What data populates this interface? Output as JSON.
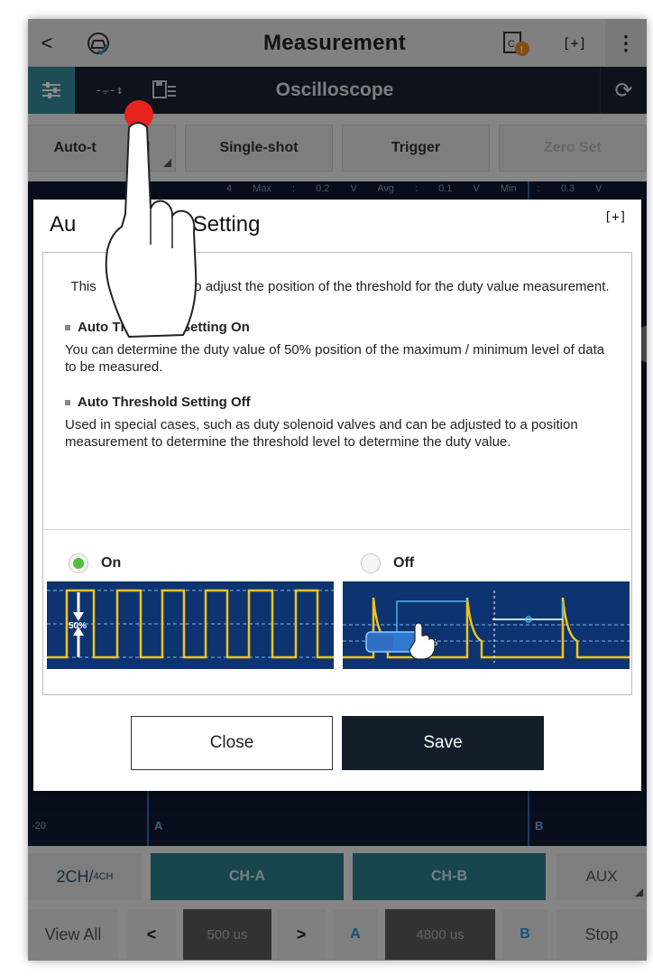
{
  "topbar": {
    "back_glyph": "<",
    "title": "Measurement",
    "fullscreen_glyph": "[+]",
    "menu_glyph": "⋮"
  },
  "scopebar": {
    "title": "Oscilloscope",
    "threshold_glyph": "-⨪-↕",
    "refresh_glyph": "⟳"
  },
  "tabs": {
    "auto": "Auto-t",
    "auto_tail": "d",
    "single": "Single-shot",
    "trigger": "Trigger",
    "zero": "Zero Set"
  },
  "scope": {
    "minmax": "4 Max : 0.2 V Avg : 0.1 V Min : 0.3 V",
    "axis_value": "-20",
    "cursor_a": "A",
    "cursor_b": "B"
  },
  "channels": {
    "ch2": "2CH/",
    "ch4": "4CH",
    "cha": "CH-A",
    "chb": "CH-B",
    "aux": "AUX"
  },
  "controls": {
    "view_all": "View All",
    "prev": "<",
    "time1": "500 us",
    "next": ">",
    "a": "A",
    "time2": "4800 us",
    "b": "B",
    "stop": "Stop"
  },
  "dialog": {
    "title_part1": "Au",
    "title_part2": "ld Setting",
    "expand_glyph": "[+]",
    "intro_part1": "This",
    "intro_part2": "sed to adjust the position of the threshold for the duty value measurement.",
    "on_heading": "Auto Threshold Setting On",
    "on_body": "You can determine the duty value of 50% position of the maximum / minimum level of data to be measured.",
    "off_heading": "Auto Threshold Setting Off",
    "off_body": "Used in special cases, such as duty solenoid valves and can be adjusted to a position measurement to determine the threshold level to determine the duty value.",
    "radio_on": "On",
    "radio_off": "Off",
    "on_selected": true,
    "wave_label_50": "50%",
    "wave_label_pct": "%",
    "close": "Close",
    "save": "Save"
  },
  "colors": {
    "accent_teal": "#2b7e8c",
    "radio_green": "#4cc23a",
    "scope_bg": "#0d3470",
    "waveform": "#f2c21b",
    "pointer_red": "#e52420"
  }
}
